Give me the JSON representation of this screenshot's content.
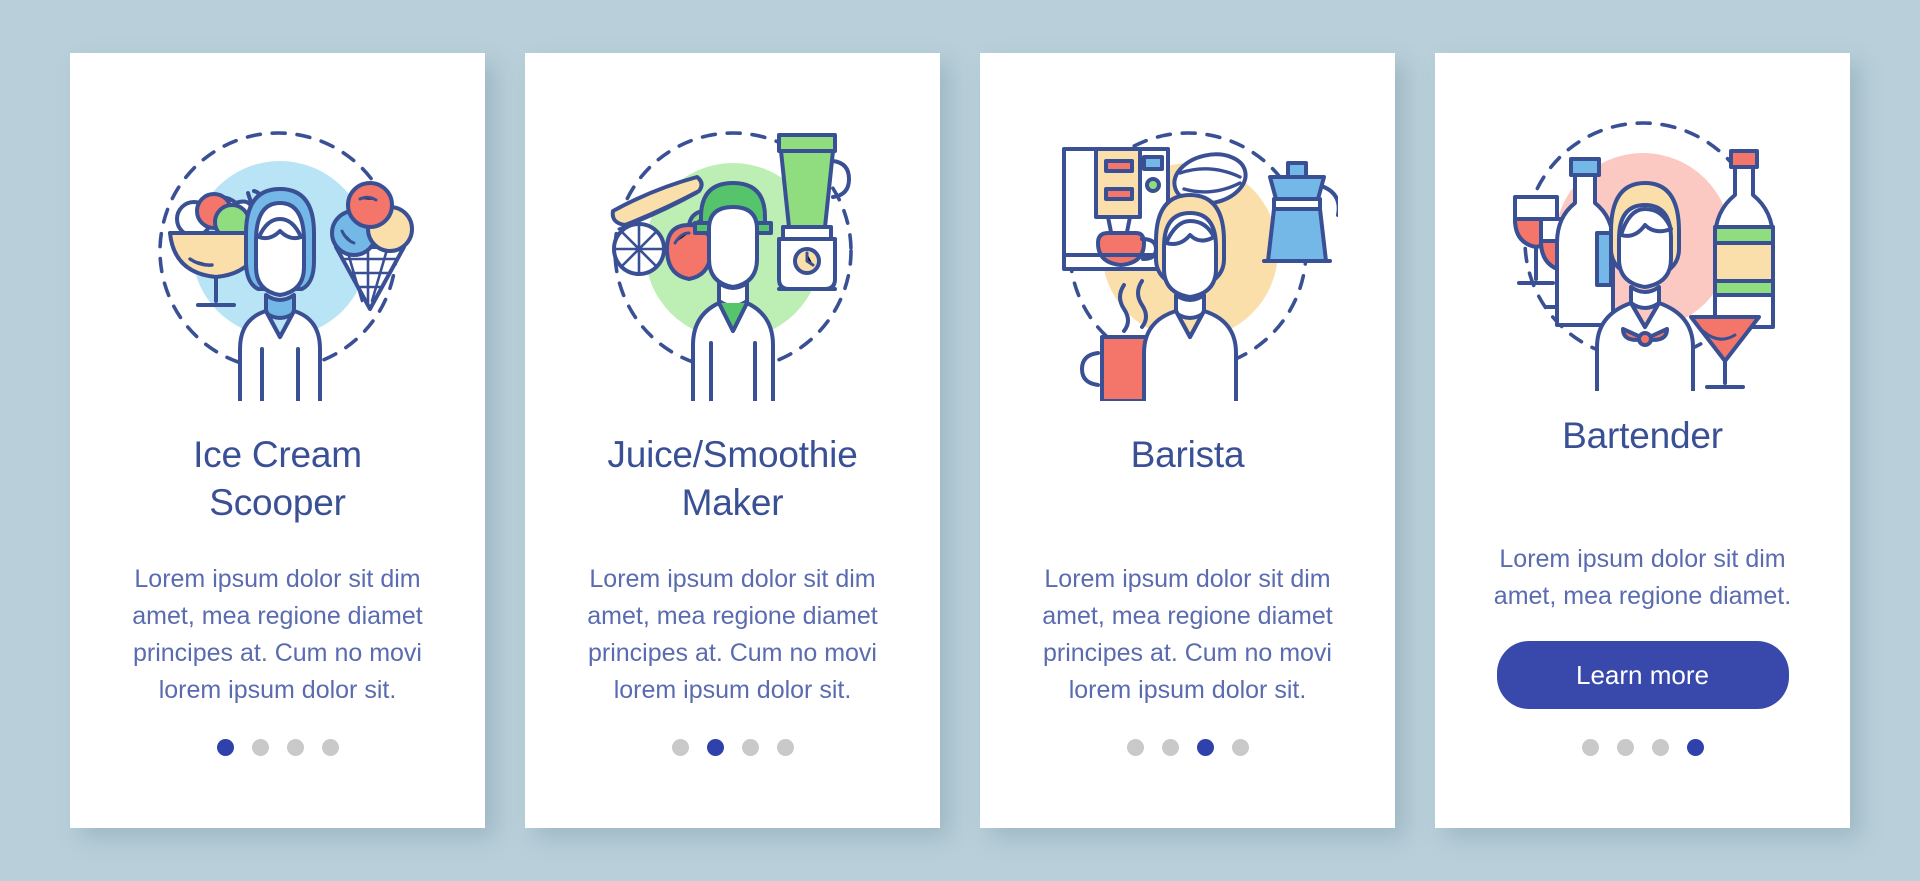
{
  "background_color": "#b9d0da",
  "accent_color": "#3949ab",
  "title_color": "#3a5095",
  "body_color": "#5a6bb0",
  "dot_active_color": "#2f42ab",
  "dot_inactive_color": "#c9c9c9",
  "cards": [
    {
      "illustration": "ice-cream-scooper-illustration",
      "blob_color": "#b8e4f5",
      "title": "Ice Cream Scooper",
      "title_lines": [
        "Ice Cream",
        "Scooper"
      ],
      "body": "Lorem ipsum dolor sit dim amet, mea regione diamet principes at. Cum no movi lorem ipsum dolor sit.",
      "cta": null,
      "dots": {
        "count": 4,
        "active_index": 0
      }
    },
    {
      "illustration": "juice-smoothie-maker-illustration",
      "blob_color": "#bdefb4",
      "title": "Juice/Smoothie Maker",
      "title_lines": [
        "Juice/Smoothie",
        "Maker"
      ],
      "body": "Lorem ipsum dolor sit dim amet, mea regione diamet principes at. Cum no movi lorem ipsum dolor sit.",
      "cta": null,
      "dots": {
        "count": 4,
        "active_index": 1
      }
    },
    {
      "illustration": "barista-illustration",
      "blob_color": "#fbdfab",
      "title": "Barista",
      "title_lines": [
        "Barista"
      ],
      "body": "Lorem ipsum dolor sit dim amet, mea regione diamet principes at. Cum no movi lorem ipsum dolor sit.",
      "cta": null,
      "dots": {
        "count": 4,
        "active_index": 2
      }
    },
    {
      "illustration": "bartender-illustration",
      "blob_color": "#fcc9c2",
      "title": "Bartender",
      "title_lines": [
        "Bartender"
      ],
      "body": "Lorem ipsum dolor sit dim amet, mea regione diamet.",
      "cta": "Learn more",
      "dots": {
        "count": 4,
        "active_index": 3
      }
    }
  ]
}
